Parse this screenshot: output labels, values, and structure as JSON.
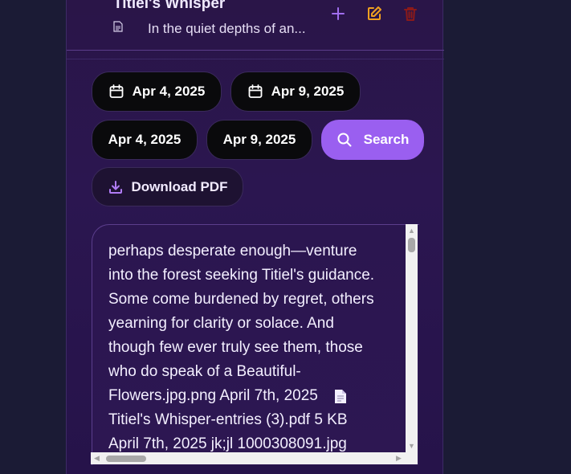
{
  "entry": {
    "title": "Titiel's Whisper",
    "snippet": "In the quiet depths of an..."
  },
  "actions": {
    "add_icon": "plus-icon",
    "edit_icon": "edit-icon",
    "delete_icon": "trash-icon"
  },
  "filters": {
    "date_from_picker": "Apr 4, 2025",
    "date_to_picker": "Apr 9, 2025",
    "date_from_chip": "Apr 4, 2025",
    "date_to_chip": "Apr 9, 2025",
    "search_label": "Search"
  },
  "download_label": "Download PDF",
  "content": {
    "line1": "perhaps desperate enough—venture",
    "line2": "into the forest seeking Titiel's guidance.",
    "line3": "Some come burdened by regret, others",
    "line4": "yearning for clarity or solace. And",
    "line5": "though few ever truly see them, those",
    "line6": "who do speak of a    Beautiful-",
    "line7": "Flowers.jpg.png April 7th, 2025",
    "line8": "Titiel's Whisper-entries (3).pdf 5 KB",
    "line9": "April 7th, 2025  jk;jl 1000308091.jpg"
  },
  "colors": {
    "background": "#1b1b35",
    "panel": "#2a1548",
    "accent": "#9a5ff0",
    "edit": "#f0a020",
    "delete": "#8b1a1a"
  }
}
